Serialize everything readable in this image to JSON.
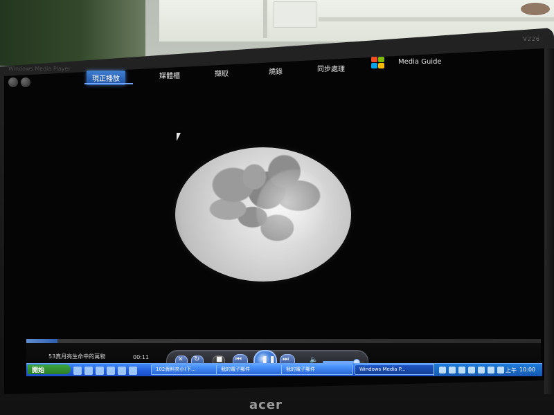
{
  "monitor": {
    "brand_top": "V226",
    "brand_logo": "acer"
  },
  "wmp": {
    "title": "Windows Media Player",
    "tabs": [
      "現正播放",
      "媒體櫃",
      "擷取",
      "燒錄",
      "同步處理"
    ],
    "active_tab_index": 0,
    "media_guide": "Media Guide",
    "now_playing_text": "53真月亮生命中的萬物",
    "time": "00:11",
    "volume_level_percent": 80,
    "seek_progress_percent": 6
  },
  "taskbar": {
    "start_label": "開始",
    "tasks": [
      {
        "label": "102資料夾小(下...",
        "active": false
      },
      {
        "label": "我的電子郵件",
        "active": false
      },
      {
        "label": "我的電子郵件",
        "active": false
      },
      {
        "label": "Windows Media P...",
        "active": true
      }
    ],
    "tray_ampm": "上午",
    "tray_time": "10:00"
  },
  "colors": {
    "accent_blue": "#2d5fb0",
    "taskbar_blue": "#245edb",
    "start_green": "#2a7d2a"
  },
  "icons": {
    "back": "back-icon",
    "forward": "forward-icon",
    "shuffle": "shuffle-icon",
    "repeat": "repeat-icon",
    "stop": "stop-icon",
    "previous": "previous-icon",
    "pause": "pause-icon",
    "next": "next-icon",
    "volume": "speaker-icon",
    "windows_logo": "windows-logo-icon"
  }
}
